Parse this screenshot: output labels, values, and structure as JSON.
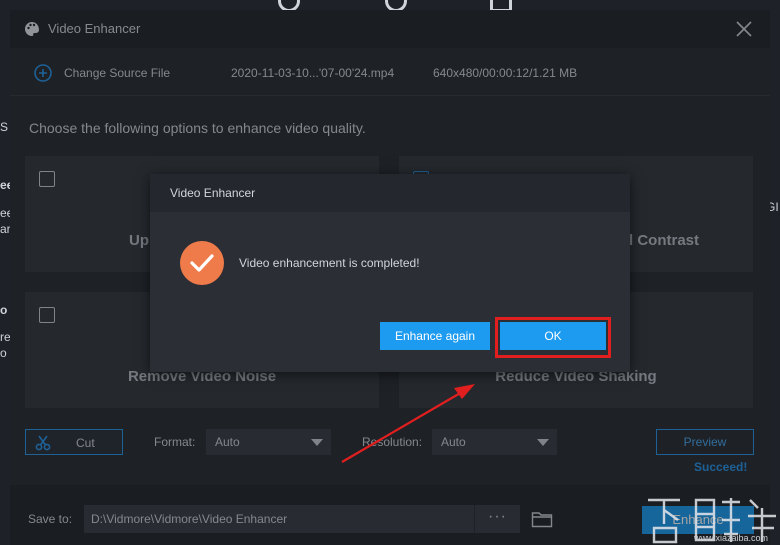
{
  "window": {
    "title": "Video Enhancer"
  },
  "source": {
    "change_label": "Change Source File",
    "file_name": "2020-11-03-10...'07-00'24.mp4",
    "file_meta": "640x480/00:00:12/1.21 MB"
  },
  "instruction": "Choose the following options to enhance video quality.",
  "options": [
    {
      "label": "Up",
      "checked": false
    },
    {
      "label": "l Contrast",
      "checked": true
    },
    {
      "label": "Remove Video Noise",
      "checked": false
    },
    {
      "label": "Reduce Video Shaking",
      "checked": false
    }
  ],
  "toolbar": {
    "cut_label": "Cut",
    "format_label": "Format:",
    "format_value": "Auto",
    "resolution_label": "Resolution:",
    "resolution_value": "Auto",
    "preview_label": "Preview",
    "status": "Succeed!"
  },
  "footer": {
    "save_label": "Save to:",
    "path": "D:\\Vidmore\\Vidmore\\Video Enhancer",
    "browse_label": "···",
    "enhance_label": "Enhance"
  },
  "dialog": {
    "title": "Video Enhancer",
    "message": "Video enhancement is completed!",
    "again_label": "Enhance again",
    "ok_label": "OK"
  },
  "background": {
    "left_edge_text": [
      "S",
      "ee",
      "ee",
      "ar",
      "o",
      "rea",
      "o"
    ],
    "right_edge_text": "GI"
  },
  "watermark": {
    "url": "www.xiazaiba.com"
  },
  "colors": {
    "accent": "#1d9bf0",
    "success_icon": "#f07b4a",
    "highlight": "#e11f1f"
  }
}
